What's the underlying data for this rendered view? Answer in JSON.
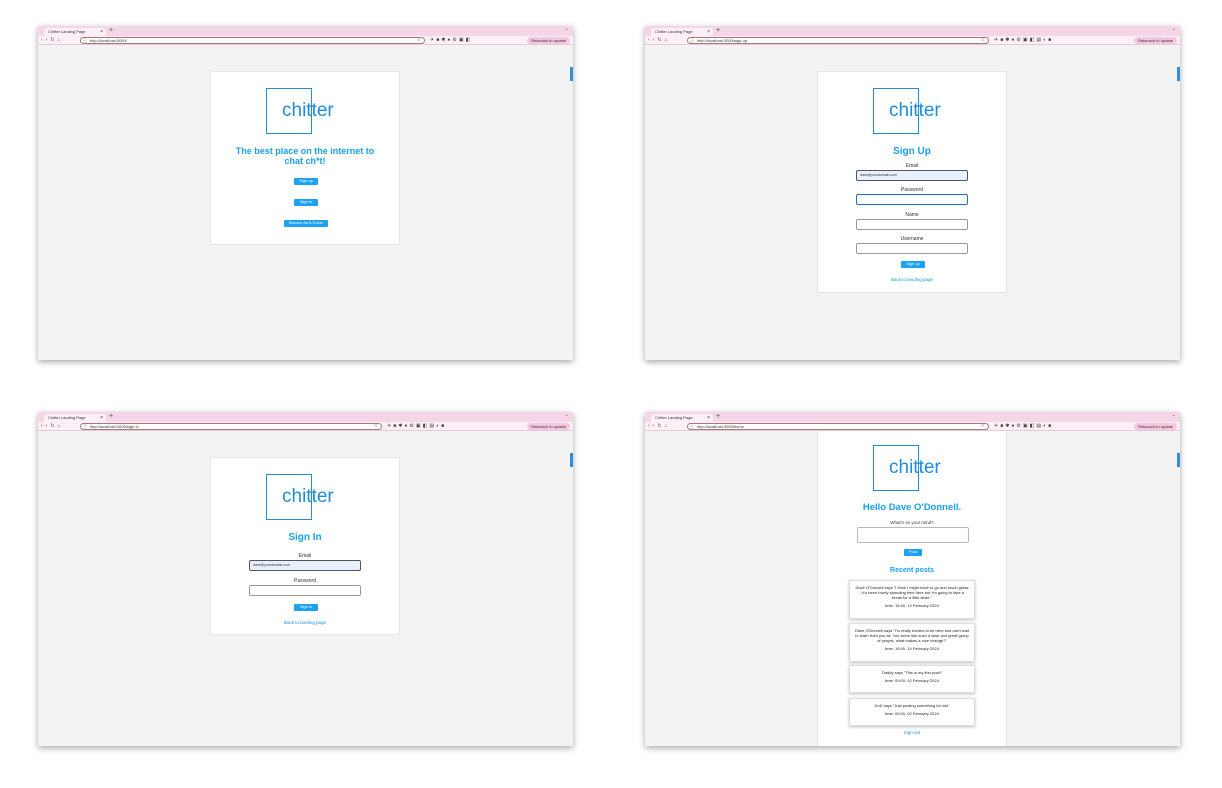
{
  "browser": {
    "tab_title": "Chitter Landing Page",
    "new_tab": "+",
    "tab_close": "×",
    "relaunch_label": "Relaunch to update",
    "address_info_icon": "info-icon",
    "bookmark_icon": "star-icon"
  },
  "landing": {
    "url": "http://localhost:3000/",
    "logo": "chitter",
    "headline": "The best place on the internet to chat ch*t!",
    "signup_button": "Sign up",
    "signin_button": "Sign in",
    "guest_button": "Browse As A Guest"
  },
  "signup": {
    "url": "http://localhost:3000/sign-up",
    "logo": "chitter",
    "title": "Sign Up",
    "email_label": "Email",
    "email_value": "dave@yourdomain.com",
    "password_label": "Password",
    "name_label": "Name",
    "username_label": "Username",
    "submit_button": "Sign up",
    "back_link": "Back to landing page"
  },
  "signin": {
    "url": "http://localhost:3000/sign-in",
    "logo": "chitter",
    "title": "Sign In",
    "email_label": "Email",
    "email_value": "dave@yourdomain.com",
    "password_label": "Password",
    "submit_button": "Sign in",
    "back_link": "Back to landing page"
  },
  "home": {
    "url": "http://localhost:3000/home",
    "logo": "chitter",
    "greeting": "Hello Dave O'Donnell.",
    "prompt_label": "What's on your mind?",
    "post_button": "Post",
    "recent_title": "Recent posts",
    "posts": [
      {
        "text": "Dave O'Donnell says \"I think I might have to go and touch grass - it's been lovely spending time here but I'm going to take a break for a little while.\"",
        "time": "time: 15:40, 14 February 2024"
      },
      {
        "text": "Dave O'Donnell says \"I'm really excited to be here and can't wait to learn from you all. You seem like such a wise and great group of people, what makes a nice change?\"",
        "time": "time: 15:40, 14 February 2024"
      },
      {
        "text": "Daddy says \"This is my first post!\"",
        "time": "time: 00:00, 02 February 2024"
      },
      {
        "text": "DoD says \"Just posting something for lols\"",
        "time": "time: 00:00, 02 February 2024"
      }
    ],
    "signout_link": "Sign out"
  }
}
